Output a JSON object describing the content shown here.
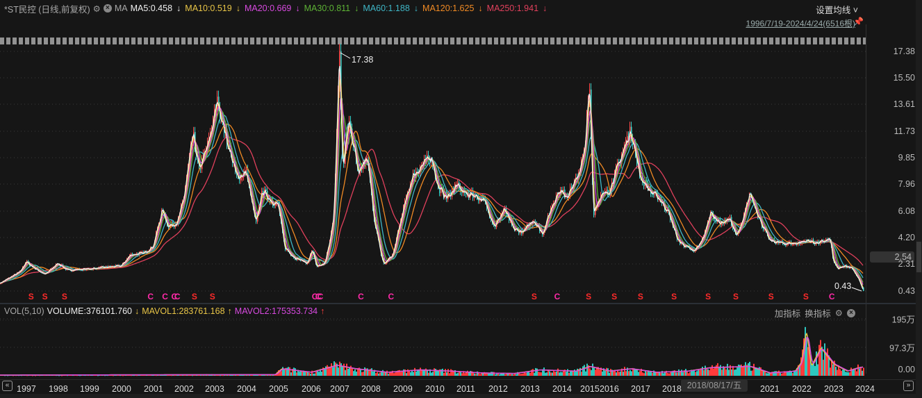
{
  "header": {
    "title": "*ST民控 (日线,前复权)",
    "ma_label": "MA",
    "ma_items": [
      {
        "label": "MA5:0.458",
        "arrow": "↓",
        "color": "#f0f0f0"
      },
      {
        "label": "MA10:0.519",
        "arrow": "↓",
        "color": "#e8c547"
      },
      {
        "label": "MA20:0.669",
        "arrow": "↓",
        "color": "#d84ae0"
      },
      {
        "label": "MA30:0.811",
        "arrow": "↓",
        "color": "#5db235"
      },
      {
        "label": "MA60:1.188",
        "arrow": "↓",
        "color": "#3fb6c6"
      },
      {
        "label": "MA120:1.625",
        "arrow": "↓",
        "color": "#f08a24"
      },
      {
        "label": "MA250:1.941",
        "arrow": "↓",
        "color": "#e0405c"
      }
    ],
    "settings_label": "设置均线 ˅",
    "range_label": "1996/7/19-2024/4/24(6516根)",
    "pin_icon": "pin-icon"
  },
  "price_axis": {
    "ticks": [
      "17.38",
      "15.50",
      "13.61",
      "11.73",
      "9.85",
      "7.96",
      "6.08",
      "4.20",
      "2.31",
      "0.43"
    ],
    "current_price": "2.54",
    "high_label": "17.38",
    "low_label": "0.43"
  },
  "volume_panel": {
    "indicator": "VOL(5,10)",
    "volume": "VOLUME:376101.760",
    "volume_arrow": "↓",
    "mavol1": "MAVOL1:283761.168",
    "mavol1_arrow": "↑",
    "mavol2": "MAVOL2:175353.734",
    "mavol2_arrow": "↑",
    "add_indicator": "加指标",
    "switch_indicator": "换指标",
    "ticks": [
      "195万",
      "97.3万",
      "0.00"
    ]
  },
  "x_axis": {
    "labels": [
      "1997",
      "1998",
      "1999",
      "2000",
      "2001",
      "2002",
      "2003",
      "2004",
      "2005",
      "2006",
      "2007",
      "2008",
      "2009",
      "2010",
      "2011",
      "2012",
      "2013",
      "2014",
      "2015",
      "2016",
      "2017",
      "2018",
      "2021",
      "2022",
      "2023",
      "2024"
    ],
    "tooltip": "2018/08/17/五"
  },
  "chart_data": {
    "type": "line",
    "title": "*ST民控 (日线,前复权)",
    "xlabel": "",
    "ylabel": "",
    "ylim": [
      0.43,
      17.38
    ],
    "price": [
      [
        1996.55,
        1.0
      ],
      [
        1996.9,
        1.8
      ],
      [
        1997.0,
        2.5
      ],
      [
        1997.3,
        2.0
      ],
      [
        1997.6,
        1.6
      ],
      [
        1998.0,
        2.4
      ],
      [
        1998.3,
        1.9
      ],
      [
        1999.0,
        2.0
      ],
      [
        1999.5,
        2.1
      ],
      [
        2000.0,
        2.2
      ],
      [
        2000.3,
        3.0
      ],
      [
        2000.7,
        3.1
      ],
      [
        2001.0,
        3.6
      ],
      [
        2001.3,
        6.2
      ],
      [
        2001.5,
        5.0
      ],
      [
        2001.8,
        5.3
      ],
      [
        2002.0,
        7.0
      ],
      [
        2002.3,
        11.5
      ],
      [
        2002.5,
        9.0
      ],
      [
        2002.8,
        10.8
      ],
      [
        2003.1,
        13.9
      ],
      [
        2003.4,
        11.0
      ],
      [
        2003.7,
        8.5
      ],
      [
        2004.0,
        8.8
      ],
      [
        2004.3,
        5.2
      ],
      [
        2004.5,
        7.5
      ],
      [
        2004.8,
        6.8
      ],
      [
        2005.0,
        6.5
      ],
      [
        2005.2,
        3.5
      ],
      [
        2005.5,
        2.8
      ],
      [
        2005.9,
        2.4
      ],
      [
        2006.05,
        3.4
      ],
      [
        2006.2,
        2.1
      ],
      [
        2006.5,
        2.4
      ],
      [
        2006.8,
        5.5
      ],
      [
        2007.0,
        17.38
      ],
      [
        2007.1,
        9.0
      ],
      [
        2007.3,
        12.5
      ],
      [
        2007.6,
        9.0
      ],
      [
        2007.9,
        10.0
      ],
      [
        2008.1,
        5.5
      ],
      [
        2008.4,
        2.3
      ],
      [
        2008.7,
        3.0
      ],
      [
        2009.0,
        6.0
      ],
      [
        2009.3,
        8.5
      ],
      [
        2009.6,
        9.3
      ],
      [
        2009.9,
        10.0
      ],
      [
        2010.1,
        7.8
      ],
      [
        2010.4,
        7.0
      ],
      [
        2010.7,
        7.9
      ],
      [
        2011.0,
        7.3
      ],
      [
        2011.3,
        7.2
      ],
      [
        2011.6,
        6.7
      ],
      [
        2011.9,
        5.0
      ],
      [
        2012.2,
        6.2
      ],
      [
        2012.5,
        4.8
      ],
      [
        2012.8,
        4.6
      ],
      [
        2013.1,
        5.5
      ],
      [
        2013.4,
        4.5
      ],
      [
        2013.7,
        6.5
      ],
      [
        2013.9,
        7.5
      ],
      [
        2014.2,
        7.2
      ],
      [
        2014.5,
        8.2
      ],
      [
        2014.8,
        10.0
      ],
      [
        2015.0,
        14.8
      ],
      [
        2015.2,
        6.0
      ],
      [
        2015.5,
        7.0
      ],
      [
        2016.0,
        7.5
      ],
      [
        2016.4,
        10.0
      ],
      [
        2016.7,
        11.8
      ],
      [
        2017.0,
        8.5
      ],
      [
        2017.3,
        7.5
      ],
      [
        2017.6,
        7.0
      ],
      [
        2017.9,
        6.0
      ],
      [
        2018.2,
        4.0
      ],
      [
        2018.5,
        3.5
      ],
      [
        2018.7,
        3.2
      ],
      [
        2019.0,
        4.2
      ],
      [
        2019.2,
        6.0
      ],
      [
        2019.5,
        5.2
      ],
      [
        2019.8,
        5.5
      ],
      [
        2020.0,
        4.3
      ],
      [
        2020.2,
        5.5
      ],
      [
        2020.4,
        7.4
      ],
      [
        2020.7,
        5.5
      ],
      [
        2021.0,
        4.0
      ],
      [
        2021.4,
        3.8
      ],
      [
        2021.8,
        3.8
      ],
      [
        2022.2,
        4.0
      ],
      [
        2022.5,
        3.8
      ],
      [
        2022.9,
        4.1
      ],
      [
        2023.0,
        2.5
      ],
      [
        2023.2,
        2.0
      ],
      [
        2023.5,
        2.2
      ],
      [
        2023.8,
        2.1
      ],
      [
        2024.1,
        1.3
      ],
      [
        2024.31,
        0.43
      ]
    ],
    "volume_wan": [
      [
        1996.55,
        3
      ],
      [
        2000,
        4
      ],
      [
        2004.9,
        5
      ],
      [
        2005.1,
        30
      ],
      [
        2006,
        15
      ],
      [
        2006.9,
        45
      ],
      [
        2007.5,
        30
      ],
      [
        2008.5,
        15
      ],
      [
        2009.5,
        25
      ],
      [
        2010.5,
        20
      ],
      [
        2011.5,
        12
      ],
      [
        2012.5,
        10
      ],
      [
        2013.3,
        25
      ],
      [
        2014.5,
        20
      ],
      [
        2015.0,
        40
      ],
      [
        2016.0,
        20
      ],
      [
        2016.7,
        30
      ],
      [
        2017.5,
        15
      ],
      [
        2018.5,
        20
      ],
      [
        2019.2,
        35
      ],
      [
        2020.4,
        40
      ],
      [
        2021.0,
        12
      ],
      [
        2021.8,
        20
      ],
      [
        2022.0,
        60
      ],
      [
        2022.15,
        195
      ],
      [
        2022.3,
        40
      ],
      [
        2022.6,
        120
      ],
      [
        2023.0,
        50
      ],
      [
        2023.6,
        20
      ],
      [
        2024.1,
        35
      ],
      [
        2024.31,
        38
      ]
    ],
    "signals": [
      {
        "t": "S",
        "x": 1997.17
      },
      {
        "t": "S",
        "x": 1997.6
      },
      {
        "t": "S",
        "x": 1998.22
      },
      {
        "t": "C",
        "x": 2000.93
      },
      {
        "t": "C",
        "x": 2001.4
      },
      {
        "t": "C",
        "x": 2001.7
      },
      {
        "t": "C",
        "x": 2001.8
      },
      {
        "t": "S",
        "x": 2002.36
      },
      {
        "t": "S",
        "x": 2002.95
      },
      {
        "t": "C",
        "x": 2006.15
      },
      {
        "t": "C",
        "x": 2006.27
      },
      {
        "t": "C",
        "x": 2006.34
      },
      {
        "t": "C",
        "x": 2007.7
      },
      {
        "t": "C",
        "x": 2008.65
      },
      {
        "t": "S",
        "x": 2013.15
      },
      {
        "t": "C",
        "x": 2013.87
      },
      {
        "t": "S",
        "x": 2014.98
      },
      {
        "t": "S",
        "x": 2016.18
      },
      {
        "t": "S",
        "x": 2017.02
      },
      {
        "t": "S",
        "x": 2018.09
      },
      {
        "t": "S",
        "x": 2019.15
      },
      {
        "t": "S",
        "x": 2019.98
      },
      {
        "t": "S",
        "x": 2021.06
      },
      {
        "t": "S",
        "x": 2022.15
      },
      {
        "t": "C",
        "x": 2022.96
      }
    ],
    "signal_colors": {
      "S": "#ff2a2a",
      "C": "#ff2aa8"
    }
  }
}
